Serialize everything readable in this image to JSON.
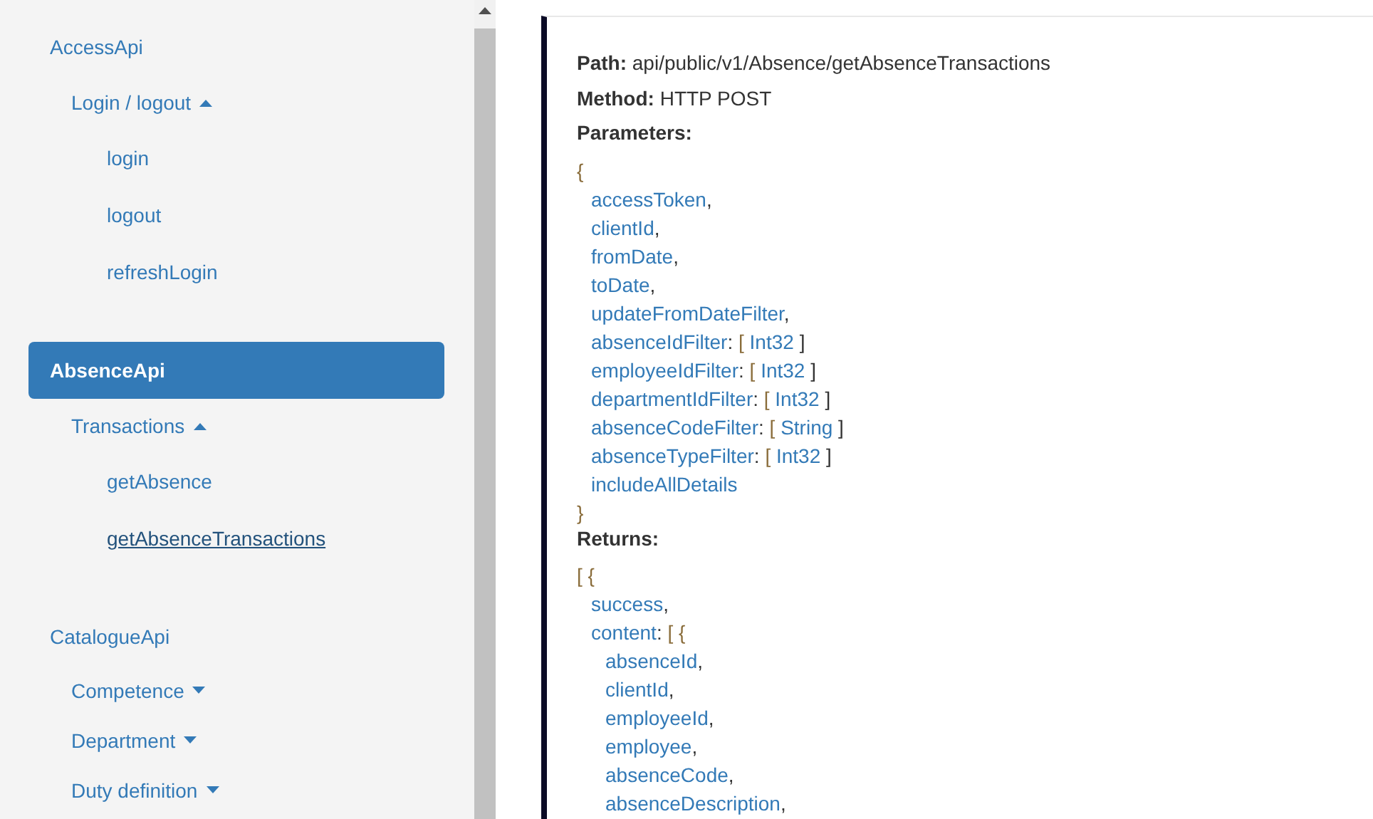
{
  "sidebar": {
    "groups": [
      {
        "title": "AccessApi",
        "selected": false,
        "sections": [
          {
            "label": "Login / logout",
            "expanded": true,
            "items": [
              {
                "label": "login",
                "selected": false
              },
              {
                "label": "logout",
                "selected": false
              },
              {
                "label": "refreshLogin",
                "selected": false
              }
            ]
          }
        ]
      },
      {
        "title": "AbsenceApi",
        "selected": true,
        "sections": [
          {
            "label": "Transactions",
            "expanded": true,
            "items": [
              {
                "label": "getAbsence",
                "selected": false
              },
              {
                "label": "getAbsenceTransactions",
                "selected": true
              }
            ]
          }
        ]
      },
      {
        "title": "CatalogueApi",
        "selected": false,
        "sections": [
          {
            "label": "Competence",
            "expanded": false
          },
          {
            "label": "Department",
            "expanded": false
          },
          {
            "label": "Duty definition",
            "expanded": false
          }
        ]
      }
    ]
  },
  "endpoint": {
    "path_label": "Path:",
    "path": "api/public/v1/Absence/getAbsenceTransactions",
    "method_label": "Method:",
    "method": "HTTP POST",
    "parameters_label": "Parameters:",
    "parameters": {
      "open": "{",
      "close": "}",
      "fields": [
        {
          "name": "accessToken",
          "punct": ","
        },
        {
          "name": "clientId",
          "punct": ","
        },
        {
          "name": "fromDate",
          "punct": ","
        },
        {
          "name": "toDate",
          "punct": ","
        },
        {
          "name": "updateFromDateFilter",
          "punct": ","
        },
        {
          "name": "absenceIdFilter",
          "punct": ":",
          "open": "[",
          "type": "Int32",
          "close": "]"
        },
        {
          "name": "employeeIdFilter",
          "punct": ":",
          "open": "[",
          "type": "Int32",
          "close": "]"
        },
        {
          "name": "departmentIdFilter",
          "punct": ":",
          "open": "[",
          "type": "Int32",
          "close": "]"
        },
        {
          "name": "absenceCodeFilter",
          "punct": ":",
          "open": "[",
          "type": "String",
          "close": "]"
        },
        {
          "name": "absenceTypeFilter",
          "punct": ":",
          "open": "[",
          "type": "Int32",
          "close": "]"
        },
        {
          "name": "includeAllDetails"
        }
      ]
    },
    "returns_label": "Returns:",
    "returns": {
      "open": "[ {",
      "fields": [
        {
          "name": "success",
          "punct": ","
        },
        {
          "name": "content",
          "punct": ":",
          "open": "[ {",
          "children": [
            {
              "name": "absenceId",
              "punct": ","
            },
            {
              "name": "clientId",
              "punct": ","
            },
            {
              "name": "employeeId",
              "punct": ","
            },
            {
              "name": "employee",
              "punct": ","
            },
            {
              "name": "absenceCode",
              "punct": ","
            },
            {
              "name": "absenceDescription",
              "punct": ","
            }
          ]
        }
      ]
    }
  }
}
